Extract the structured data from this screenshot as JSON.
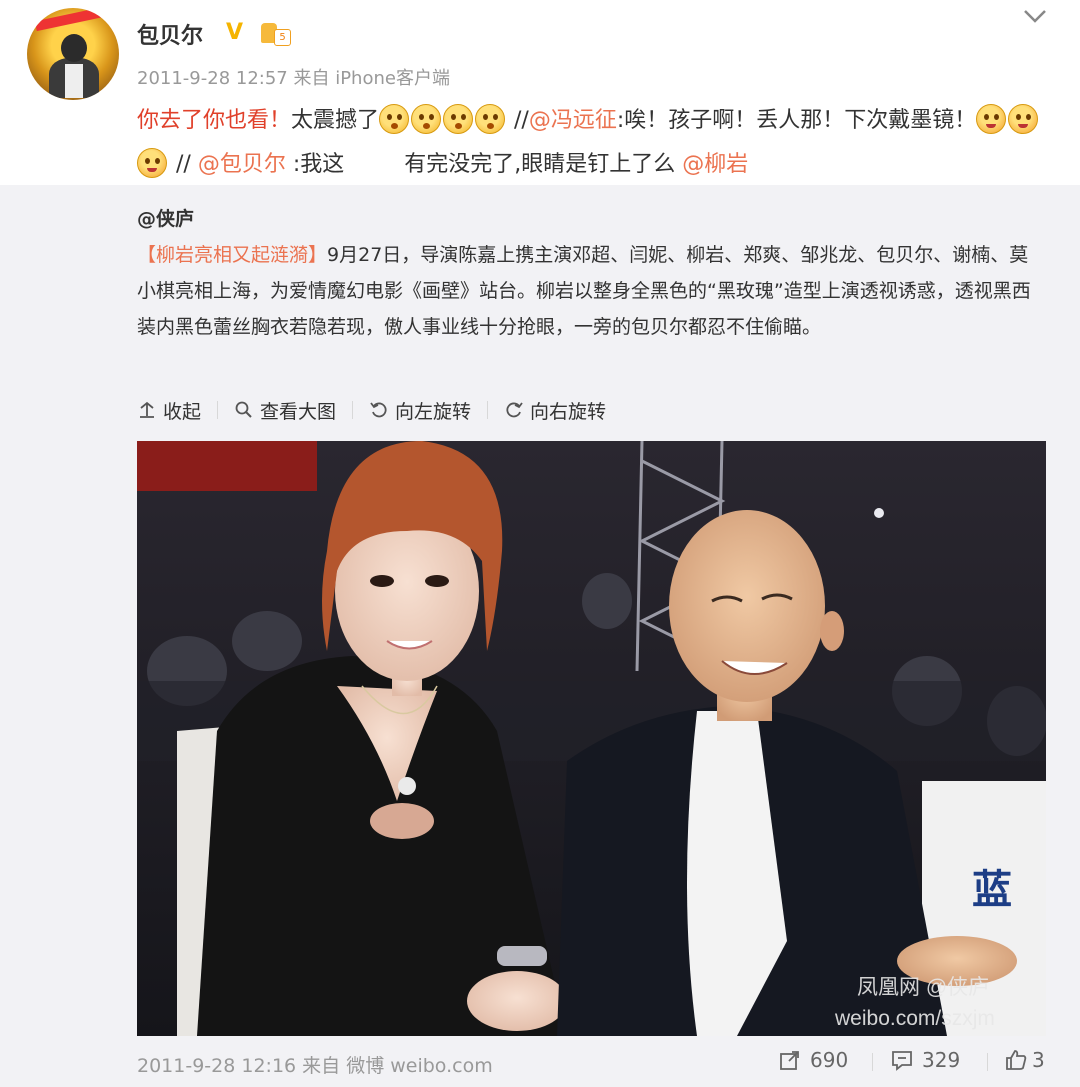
{
  "post": {
    "username": "包贝尔",
    "verified_badge": "V",
    "level_badge": "5",
    "meta": "2011-9-28 12:57 来自 iPhone客户端",
    "text_red": "你去了你也看！",
    "text_1": "太震撼了",
    "sep_1": " //",
    "mention_1": "@冯远征",
    "text_2": ":唉！孩子啊！丢人那！下次戴墨镜！",
    "sep_2": " // ",
    "mention_2": "@包贝尔",
    "text_3": " :我这",
    "text_4": "有完没完了,眼睛是钉上了么 ",
    "mention_3": "@柳岩"
  },
  "repost": {
    "author": "@侠庐",
    "tag": "【柳岩亮相又起涟漪】",
    "body": "9月27日，导演陈嘉上携主演邓超、闫妮、柳岩、郑爽、邹兆龙、包贝尔、谢楠、莫小棋亮相上海，为爱情魔幻电影《画壁》站台。柳岩以整身全黑色的“黑玫瑰”造型上演透视诱惑，透视黑西装内黑色蕾丝胸衣若隐若现，傲人事业线十分抢眼，一旁的包贝尔都忍不住偷瞄。",
    "tools": {
      "collapse": "收起",
      "view_large": "查看大图",
      "rotate_left": "向左旋转",
      "rotate_right": "向右旋转"
    },
    "photo_sign": "蓝",
    "watermark_1": "凤凰网 @侠庐",
    "watermark_2": "weibo.com/szxjm",
    "footer_meta": "2011-9-28 12:16 来自 微博 weibo.com",
    "forwards": "690",
    "comments": "329",
    "likes": "3"
  },
  "colors": {
    "link": "#eb7350",
    "red_text": "#e0402a",
    "repost_bg": "#f2f2f5"
  }
}
